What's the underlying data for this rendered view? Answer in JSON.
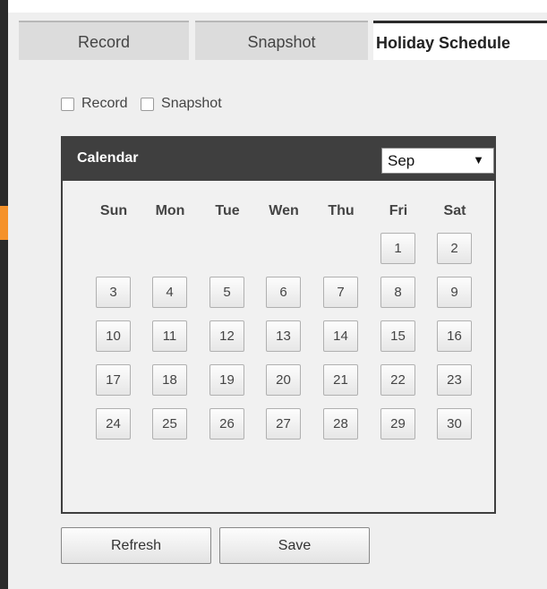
{
  "tabs": [
    {
      "label": "Record"
    },
    {
      "label": "Snapshot"
    },
    {
      "label": "Holiday Schedule",
      "active": true
    }
  ],
  "options": {
    "record_label": "Record",
    "snapshot_label": "Snapshot",
    "record_checked": false,
    "snapshot_checked": false
  },
  "calendar": {
    "title": "Calendar",
    "month": "Sep",
    "weekdays": [
      "Sun",
      "Mon",
      "Tue",
      "Wen",
      "Thu",
      "Fri",
      "Sat"
    ],
    "first_weekday_index": 5,
    "days": [
      "1",
      "2",
      "3",
      "4",
      "5",
      "6",
      "7",
      "8",
      "9",
      "10",
      "11",
      "12",
      "13",
      "14",
      "15",
      "16",
      "17",
      "18",
      "19",
      "20",
      "21",
      "22",
      "23",
      "24",
      "25",
      "26",
      "27",
      "28",
      "29",
      "30"
    ]
  },
  "buttons": {
    "refresh": "Refresh",
    "save": "Save"
  },
  "colors": {
    "accent": "#f5922b",
    "header_dark": "#3f3f3f"
  }
}
